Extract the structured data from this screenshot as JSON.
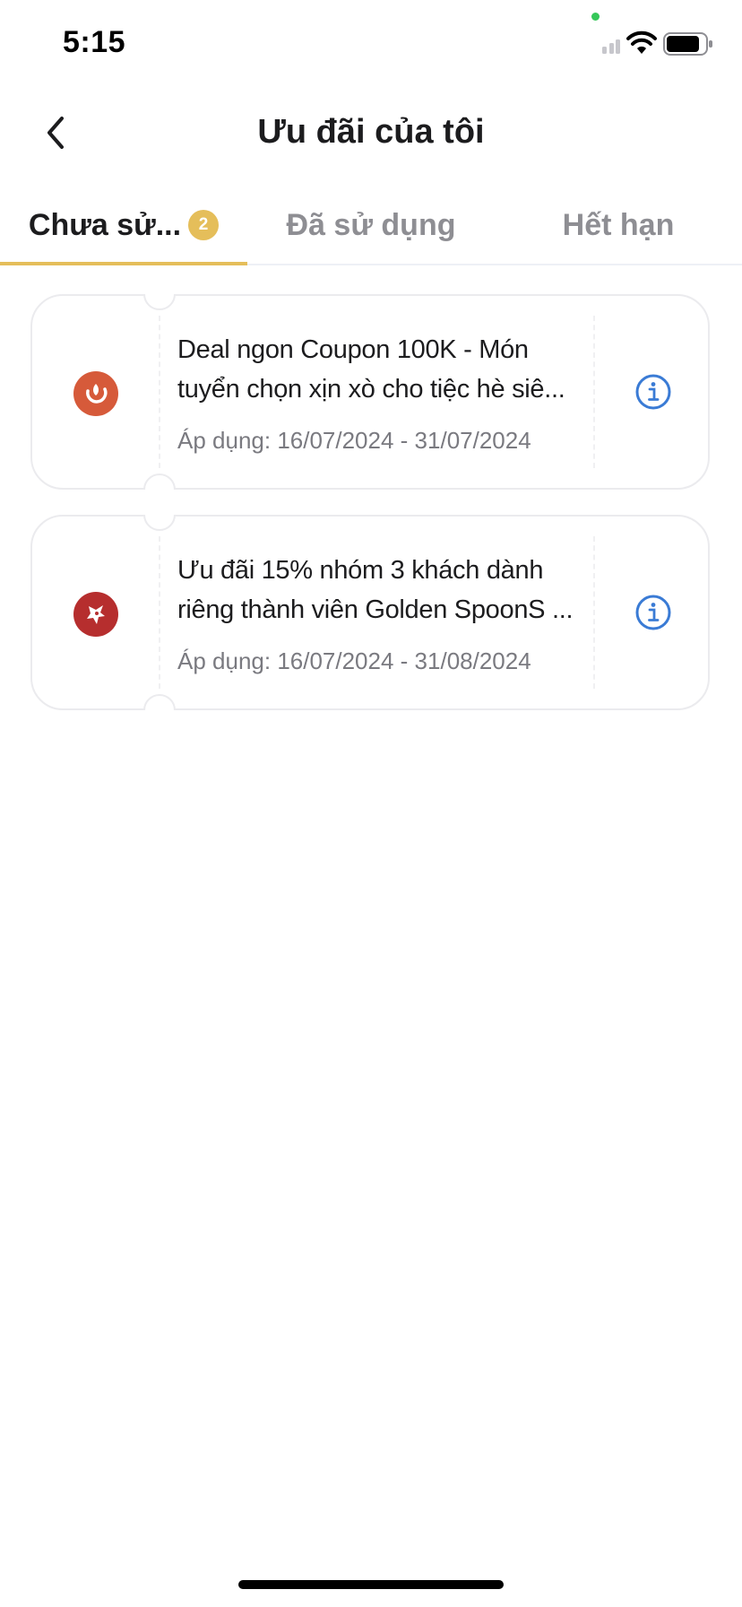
{
  "status_bar": {
    "time": "5:15"
  },
  "header": {
    "title": "Ưu đãi của tôi"
  },
  "tabs": [
    {
      "label": "Chưa sử...",
      "badge": "2",
      "active": true
    },
    {
      "label": "Đã sử dụng",
      "active": false
    },
    {
      "label": "Hết hạn",
      "active": false
    }
  ],
  "vouchers": [
    {
      "title": "Deal ngon Coupon 100K - Món tuyển chọn xịn xò cho tiệc hè siê...",
      "dates": "Áp dụng: 16/07/2024 - 31/07/2024",
      "logo_color": "#d65a3a",
      "logo_icon": "flame-swirl-logo"
    },
    {
      "title": "Ưu đãi 15% nhóm 3 khách dành riêng thành viên Golden SpoonS ...",
      "dates": "Áp dụng: 16/07/2024 - 31/08/2024",
      "logo_color": "#b62e2e",
      "logo_icon": "dragon-logo"
    }
  ],
  "colors": {
    "accent": "#e5be5a",
    "info_blue": "#3a7bd5",
    "tab_inactive": "#8e8e93"
  }
}
